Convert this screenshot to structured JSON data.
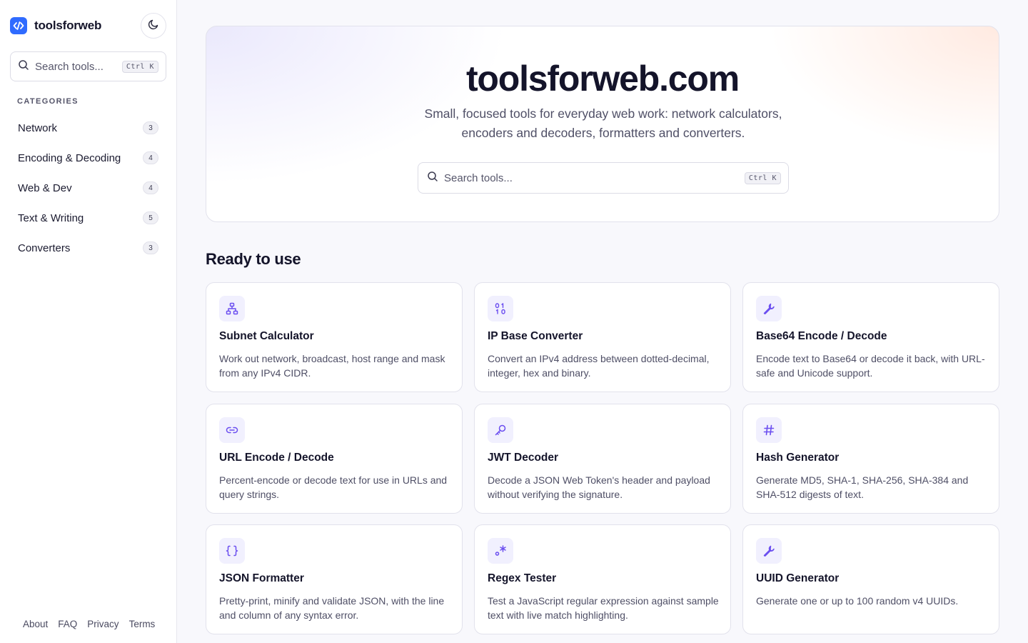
{
  "brand": {
    "name": "toolsforweb"
  },
  "sidebar": {
    "search_placeholder": "Search tools...",
    "search_shortcut": "Ctrl K",
    "categories_title": "CATEGORIES",
    "categories": [
      {
        "label": "Network",
        "count": "3"
      },
      {
        "label": "Encoding & Decoding",
        "count": "4"
      },
      {
        "label": "Web & Dev",
        "count": "4"
      },
      {
        "label": "Text & Writing",
        "count": "5"
      },
      {
        "label": "Converters",
        "count": "3"
      }
    ],
    "footer_links": [
      "About",
      "FAQ",
      "Privacy",
      "Terms"
    ]
  },
  "hero": {
    "title": "toolsforweb.com",
    "subtitle": "Small, focused tools for everyday web work: network calculators, encoders and decoders, formatters and converters.",
    "search_placeholder": "Search tools...",
    "search_shortcut": "Ctrl K"
  },
  "section": {
    "title": "Ready to use"
  },
  "tools": [
    {
      "icon": "network-icon",
      "title": "Subnet Calculator",
      "desc": "Work out network, broadcast, host range and mask from any IPv4 CIDR."
    },
    {
      "icon": "binary-icon",
      "title": "IP Base Converter",
      "desc": "Convert an IPv4 address between dotted-decimal, integer, hex and binary."
    },
    {
      "icon": "wrench-icon",
      "title": "Base64 Encode / Decode",
      "desc": "Encode text to Base64 or decode it back, with URL-safe and Unicode support."
    },
    {
      "icon": "link-icon",
      "title": "URL Encode / Decode",
      "desc": "Percent-encode or decode text for use in URLs and query strings."
    },
    {
      "icon": "key-icon",
      "title": "JWT Decoder",
      "desc": "Decode a JSON Web Token's header and payload without verifying the signature."
    },
    {
      "icon": "hash-icon",
      "title": "Hash Generator",
      "desc": "Generate MD5, SHA-1, SHA-256, SHA-384 and SHA-512 digests of text."
    },
    {
      "icon": "braces-icon",
      "title": "JSON Formatter",
      "desc": "Pretty-print, minify and validate JSON, with the line and column of any syntax error."
    },
    {
      "icon": "regex-icon",
      "title": "Regex Tester",
      "desc": "Test a JavaScript regular expression against sample text with live match highlighting."
    },
    {
      "icon": "wrench-icon",
      "title": "UUID Generator",
      "desc": "Generate one or up to 100 random v4 UUIDs."
    }
  ],
  "colors": {
    "accent": "#6b4ef0",
    "brand": "#2f6bff",
    "icon_bg": "#f1f0fe"
  }
}
